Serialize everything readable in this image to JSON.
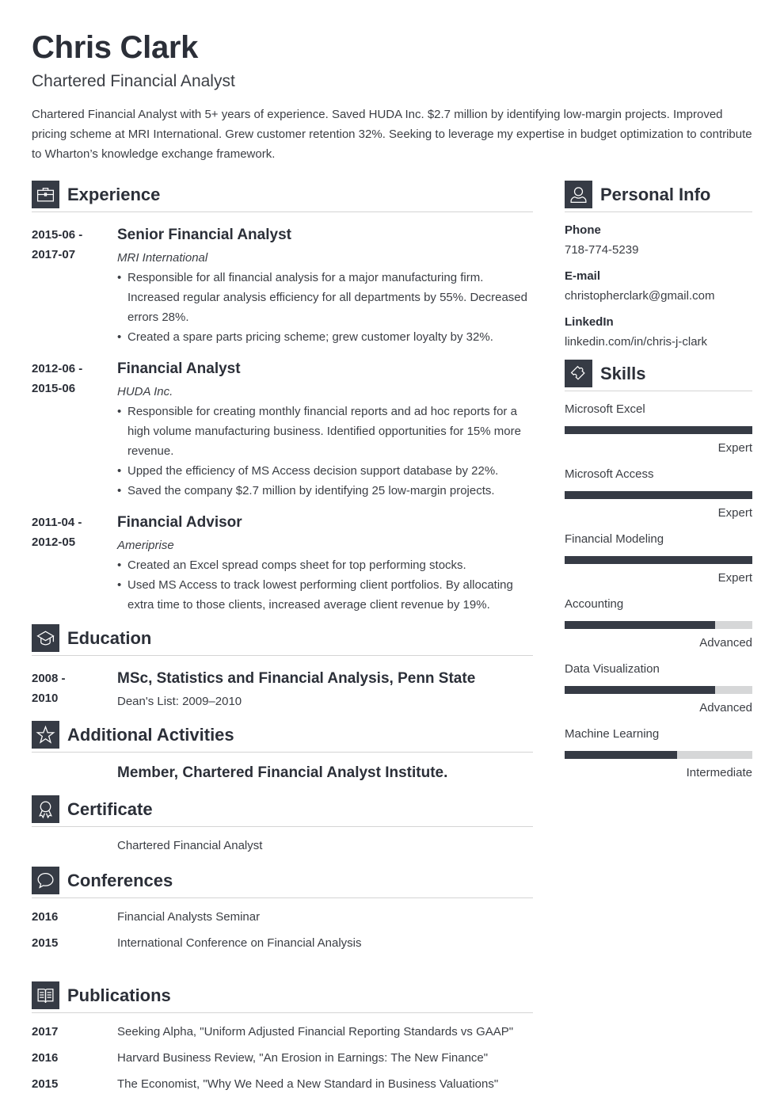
{
  "header": {
    "name": "Chris Clark",
    "title": "Chartered Financial Analyst",
    "summary": "Chartered Financial Analyst with 5+ years of experience. Saved HUDA Inc. $2.7 million by identifying low-margin projects. Improved pricing scheme at MRI International. Grew customer retention 32%. Seeking to leverage my expertise in budget optimization to contribute to Wharton’s knowledge exchange framework."
  },
  "experience": {
    "heading": "Experience",
    "icon": "briefcase-icon",
    "items": [
      {
        "date_start": "2015-06 -",
        "date_end": "2017-07",
        "title": "Senior Financial Analyst",
        "company": "MRI International",
        "bullets": [
          "Responsible for all financial analysis for a major manufacturing firm. Increased regular analysis efficiency for all departments by 55%. Decreased errors 28%.",
          "Created a spare parts pricing scheme; grew customer loyalty by 32%."
        ]
      },
      {
        "date_start": "2012-06 -",
        "date_end": "2015-06",
        "title": "Financial Analyst",
        "company": "HUDA Inc.",
        "bullets": [
          "Responsible for creating monthly financial reports and ad hoc reports for a high volume manufacturing business. Identified opportunities for 15% more revenue.",
          "Upped the efficiency of MS Access decision support database by 22%.",
          "Saved the company $2.7 million by identifying 25 low-margin projects."
        ]
      },
      {
        "date_start": "2011-04 -",
        "date_end": "2012-05",
        "title": "Financial Advisor",
        "company": "Ameriprise",
        "bullets": [
          "Created an Excel spread comps sheet for top performing stocks.",
          "Used MS Access to track lowest performing client portfolios. By allocating extra time to those clients, increased average client revenue by 19%."
        ]
      }
    ]
  },
  "education": {
    "heading": "Education",
    "icon": "graduation-cap-icon",
    "items": [
      {
        "date_start": "2008 -",
        "date_end": "2010",
        "degree": "MSc, Statistics and Financial Analysis, Penn State",
        "detail": "Dean's List: 2009–2010"
      }
    ]
  },
  "activities": {
    "heading": "Additional Activities",
    "icon": "star-icon",
    "text": "Member, Chartered Financial Analyst Institute."
  },
  "certificate": {
    "heading": "Certificate",
    "icon": "award-ribbon-icon",
    "text": "Chartered Financial Analyst"
  },
  "conferences": {
    "heading": "Conferences",
    "icon": "speech-bubble-icon",
    "items": [
      {
        "year": "2016",
        "text": "Financial Analysts Seminar"
      },
      {
        "year": "2015",
        "text": "International Conference on Financial Analysis"
      }
    ]
  },
  "publications": {
    "heading": "Publications",
    "icon": "open-book-icon",
    "items": [
      {
        "year": "2017",
        "text": "Seeking Alpha, \"Uniform Adjusted Financial Reporting Standards vs GAAP\""
      },
      {
        "year": "2016",
        "text": "Harvard Business Review, \"An Erosion in Earnings: The New Finance\""
      },
      {
        "year": "2015",
        "text": "The Economist, \"Why We Need a New Standard in Business Valuations\""
      }
    ]
  },
  "personal_info": {
    "heading": "Personal Info",
    "icon": "person-icon",
    "fields": [
      {
        "label": "Phone",
        "value": "718-774-5239"
      },
      {
        "label": "E-mail",
        "value": "christopherclark@gmail.com"
      },
      {
        "label": "LinkedIn",
        "value": "linkedin.com/in/chris-j-clark"
      }
    ]
  },
  "skills": {
    "heading": "Skills",
    "icon": "puzzle-piece-icon",
    "items": [
      {
        "name": "Microsoft Excel",
        "level": "Expert",
        "fill": 1.0
      },
      {
        "name": "Microsoft Access",
        "level": "Expert",
        "fill": 1.0
      },
      {
        "name": "Financial Modeling",
        "level": "Expert",
        "fill": 1.0
      },
      {
        "name": "Accounting",
        "level": "Advanced",
        "fill": 0.8
      },
      {
        "name": "Data Visualization",
        "level": "Advanced",
        "fill": 0.8
      },
      {
        "name": "Machine Learning",
        "level": "Intermediate",
        "fill": 0.6
      }
    ]
  },
  "colors": {
    "accent": "#363b45",
    "heading_text": "#2b2f38",
    "body_text": "#3b3e44",
    "divider": "#d4d4d4",
    "bar_track": "#d6d7d8"
  }
}
